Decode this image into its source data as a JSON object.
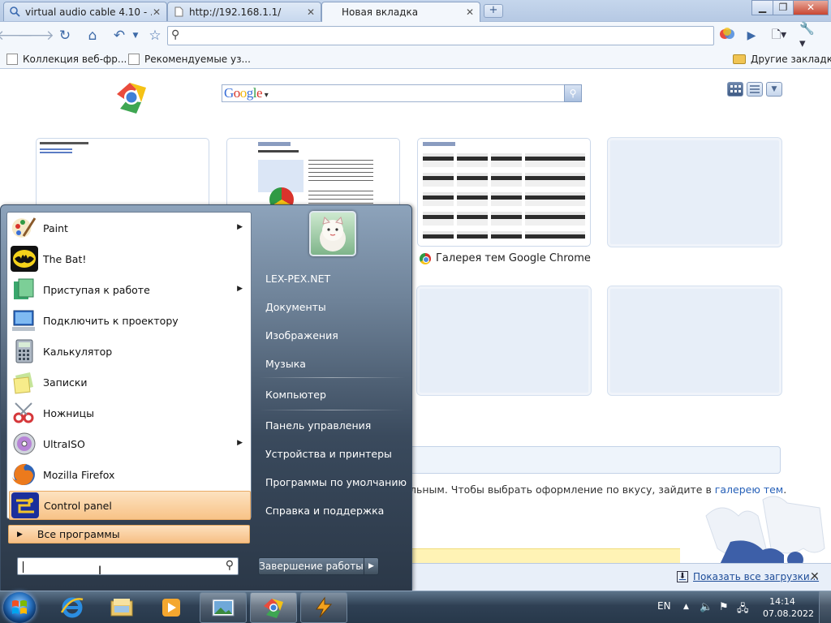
{
  "tabs": [
    {
      "title": "virtual audio cable 4.10 - ...",
      "icon": "search-icon"
    },
    {
      "title": "http://192.168.1.1/",
      "icon": "page-icon"
    },
    {
      "title": "Новая вкладка",
      "icon": "none",
      "active": true
    }
  ],
  "toolbar": {
    "omnibox_value": ""
  },
  "bookmarks": {
    "items": [
      "Коллекция веб-фр...",
      "Рекомендуемые уз..."
    ],
    "other": "Другие закладки"
  },
  "newtab": {
    "search_logo": "Google",
    "thumbnails": [
      {
        "caption": ""
      },
      {
        "caption": ""
      },
      {
        "caption": "Галерея тем Google Chrome"
      },
      {
        "caption": ""
      },
      {
        "caption": ""
      },
      {
        "caption": ""
      },
      {
        "caption": ""
      },
      {
        "caption": ""
      }
    ],
    "theme_note_text": "льным. Чтобы выбрать оформление по вкусу, зайдите в",
    "theme_note_link": "галерею тем",
    "theme_note_end": "."
  },
  "downloads": {
    "show_all": "Показать все загрузки..."
  },
  "startmenu": {
    "programs": [
      {
        "label": "Paint",
        "icon": "paint-icon",
        "submenu": true
      },
      {
        "label": "The Bat!",
        "icon": "the-bat-icon",
        "submenu": false
      },
      {
        "label": "Приступая к работе",
        "icon": "getting-started-icon",
        "submenu": true
      },
      {
        "label": "Подключить к проектору",
        "icon": "projector-icon",
        "submenu": false
      },
      {
        "label": "Калькулятор",
        "icon": "calculator-icon",
        "submenu": false
      },
      {
        "label": "Записки",
        "icon": "sticky-notes-icon",
        "submenu": false
      },
      {
        "label": "Ножницы",
        "icon": "snipping-tool-icon",
        "submenu": false
      },
      {
        "label": "UltraISO",
        "icon": "ultraiso-icon",
        "submenu": true
      },
      {
        "label": "Mozilla Firefox",
        "icon": "firefox-icon",
        "submenu": false
      },
      {
        "label": "Control panel",
        "icon": "control-panel-icon",
        "submenu": false,
        "highlighted": true
      }
    ],
    "all_programs": "Все программы",
    "search_value": "",
    "right": [
      "LEX-PEX.NET",
      "Документы",
      "Изображения",
      "Музыка",
      "Компьютер",
      "Панель управления",
      "Устройства и принтеры",
      "Программы по умолчанию",
      "Справка и поддержка"
    ],
    "shutdown": "Завершение работы"
  },
  "taskbar": {
    "lang": "EN",
    "time": "14:14",
    "date": "07.08.2022",
    "apps": [
      "internet-explorer-icon",
      "explorer-icon",
      "media-player-icon",
      "picture-viewer-icon",
      "chrome-icon",
      "winamp-icon"
    ]
  },
  "colors": {
    "highlight": "#f8c387",
    "link": "#2660b8"
  }
}
